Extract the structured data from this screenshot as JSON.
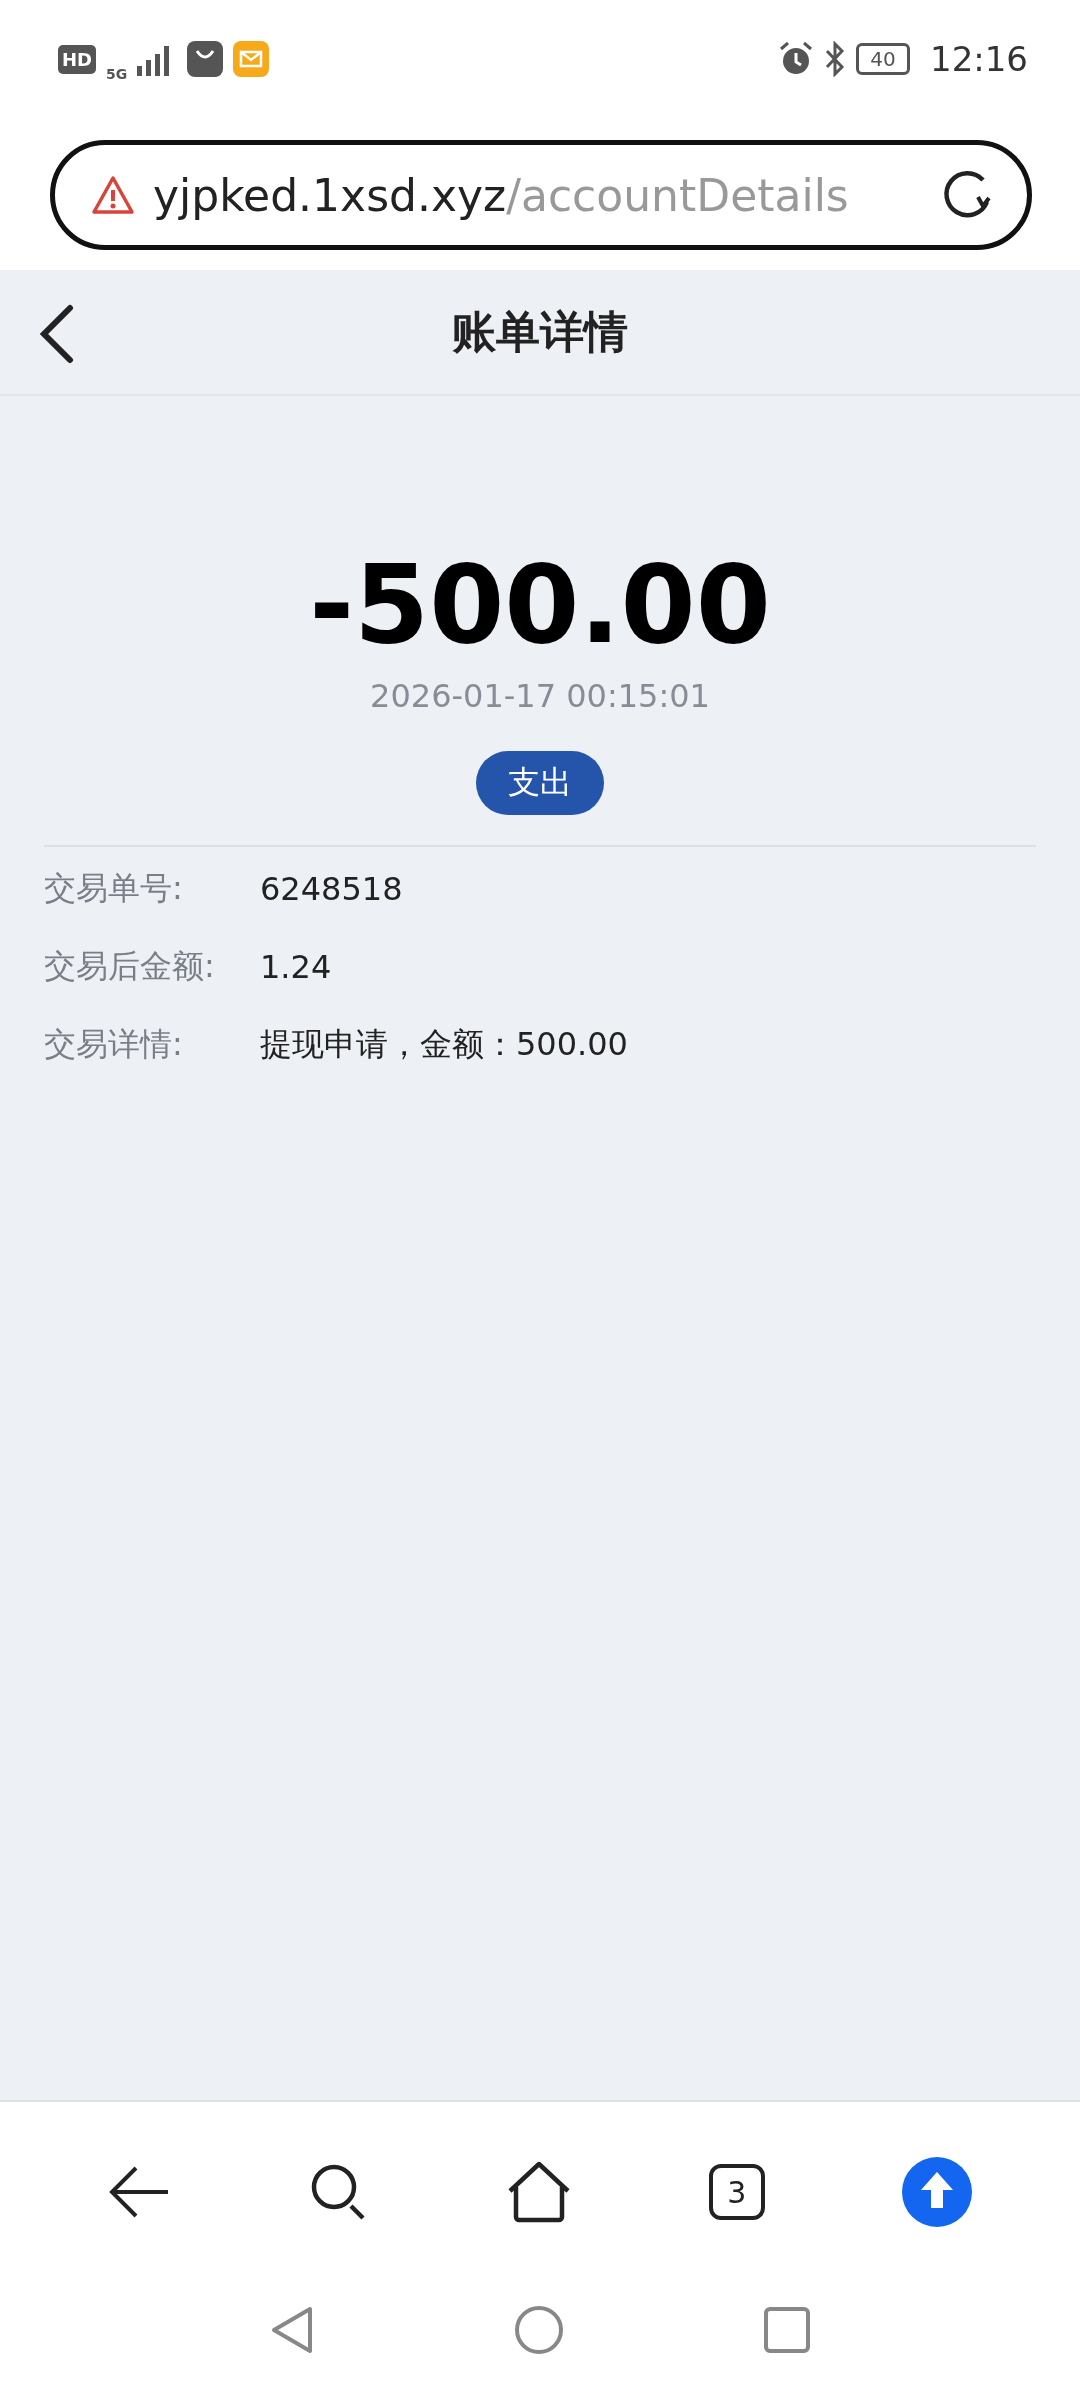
{
  "status_bar": {
    "network_badge": "HD",
    "network_type": "5G",
    "battery": "40",
    "time": "12:16"
  },
  "address_bar": {
    "domain": "yjpked.1xsd.xyz",
    "path": "/accountDetails"
  },
  "header": {
    "title": "账单详情"
  },
  "transaction": {
    "amount": "-500.00",
    "datetime": "2026-01-17 00:15:01",
    "type_label": "支出"
  },
  "details": [
    {
      "label": "交易单号:",
      "value": "6248518"
    },
    {
      "label": "交易后金额:",
      "value": "1.24"
    },
    {
      "label": "交易详情:",
      "value": "提现申请，金额：500.00"
    }
  ],
  "browser_toolbar": {
    "tab_count": "3"
  }
}
